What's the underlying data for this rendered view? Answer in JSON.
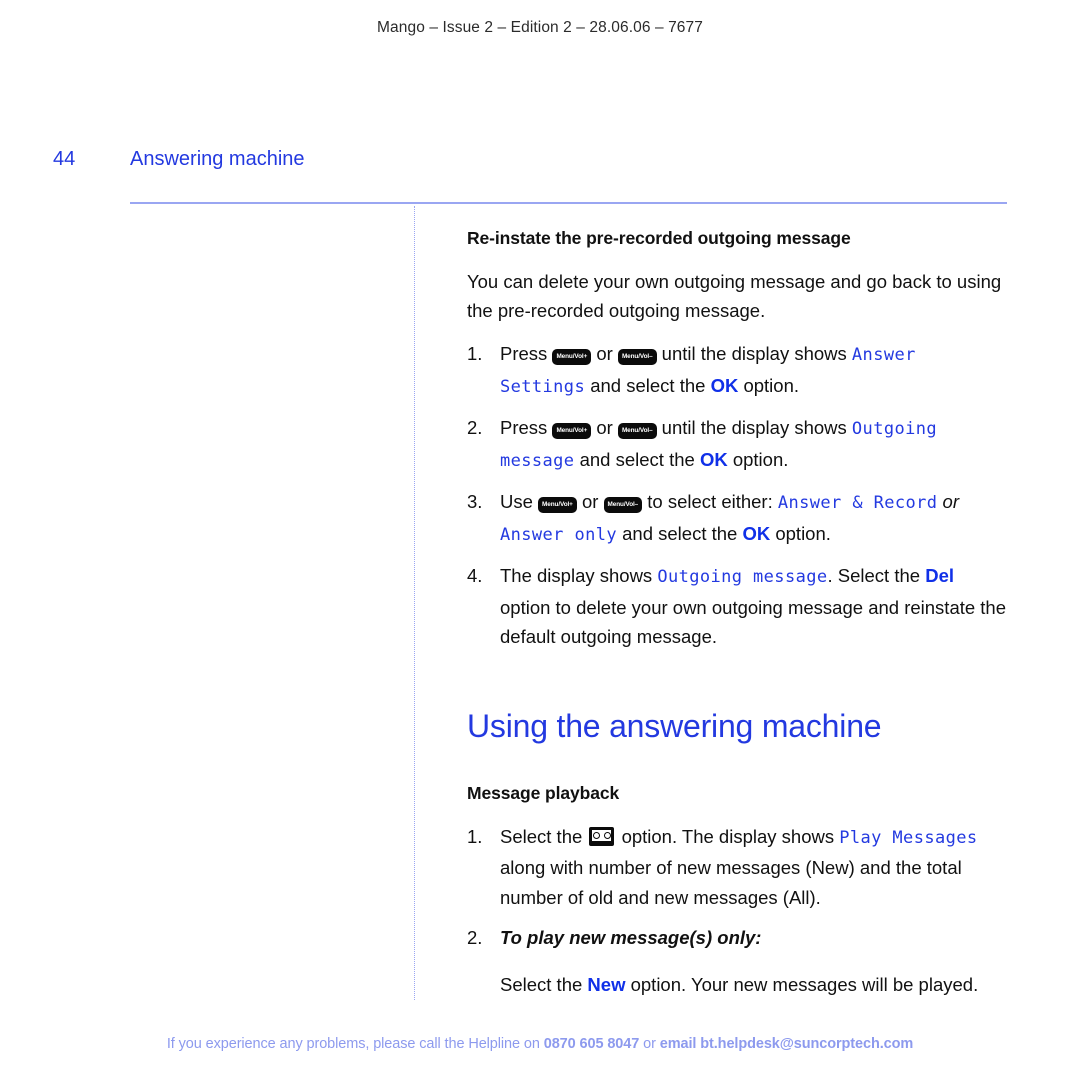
{
  "header": {
    "running_head": "Mango – Issue 2 – Edition 2 – 28.06.06 – 7677"
  },
  "page": {
    "folio": "44",
    "chapter": "Answering machine"
  },
  "colors": {
    "heading_blue": "#2339e0",
    "lcd_blue": "#2339e0",
    "accent_blue": "#1030e8",
    "rule_blue": "#9aa6f2",
    "footer_blue": "#8d9aee",
    "key_black": "#0b0b0b"
  },
  "section_one": {
    "subheading": "Re-instate the pre-recorded outgoing message",
    "intro": "You can delete your own outgoing message and go back to using the pre-recorded outgoing message.",
    "steps": [
      {
        "num": "1.",
        "pre": "Press",
        "key_a": "Menu/Vol+",
        "conj": "or",
        "key_b": "Menu/Vol–",
        "mid": "until the display shows",
        "lcd": "Answer Settings",
        "post_a": "and select the",
        "accent": "OK",
        "post_b": "option."
      },
      {
        "num": "2.",
        "pre": "Press",
        "key_a": "Menu/Vol+",
        "conj": "or",
        "key_b": "Menu/Vol–",
        "mid": "until the display shows",
        "lcd": "Outgoing message",
        "post_a": "and select the",
        "accent": "OK",
        "post_b": "option."
      },
      {
        "num": "3.",
        "pre": "Use",
        "key_a": "Menu/Vol+",
        "conj": "or",
        "key_b": "Menu/Vol–",
        "mid": "to select either:",
        "lcd_a": "Answer & Record",
        "or_italic": "or",
        "lcd_b": "Answer only",
        "post_a": "and select the",
        "accent": "OK",
        "post_b": "option."
      },
      {
        "num": "4.",
        "pre": "The display shows",
        "lcd": "Outgoing message",
        "mid": ". Select the",
        "accent": "Del",
        "post": "option to delete your own outgoing message and reinstate the default outgoing message."
      }
    ]
  },
  "section_two": {
    "heading": "Using the answering machine",
    "subheading": "Message playback",
    "steps": [
      {
        "num": "1.",
        "pre": "Select the",
        "icon": "cassette-icon",
        "mid": "option. The display shows",
        "lcd": "Play Messages",
        "post": "along with number of new messages (New) and the total number of old and new messages (All)."
      },
      {
        "num": "2.",
        "italic_lead": "To play new message(s) only:",
        "body_pre": "Select the",
        "accent": "New",
        "body_post": "option. Your new messages will be played."
      }
    ]
  },
  "footer": {
    "lead": "If you experience any problems, please call the Helpline on ",
    "phone": "0870 605 8047",
    "mid": " or ",
    "email": "email bt.helpdesk@suncorptech.com"
  }
}
